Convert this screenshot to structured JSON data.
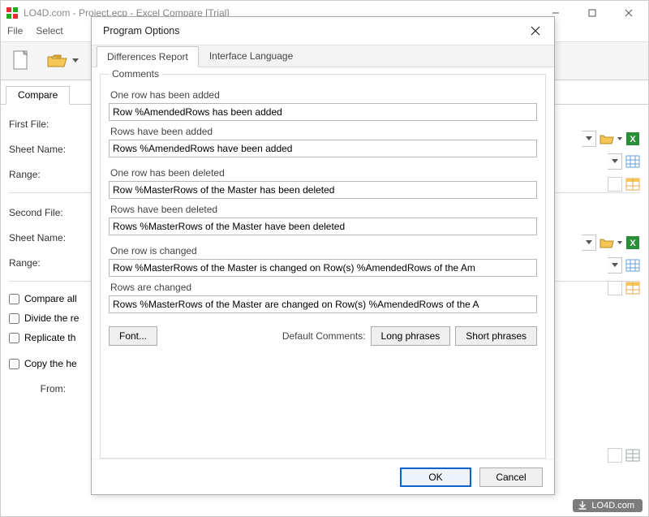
{
  "window": {
    "title": "LO4D.com - Project.ecp - Excel Compare [Trial]"
  },
  "menubar": {
    "items": [
      "File",
      "Select"
    ]
  },
  "main_tabs": {
    "compare": "Compare"
  },
  "form": {
    "first_file": "First File:",
    "second_file": "Second File:",
    "sheet_name": "Sheet Name:",
    "range": "Range:",
    "compare_all": "Compare all",
    "divide": "Divide the re",
    "replicate": "Replicate th",
    "copy_header": "Copy the he",
    "from": "From:"
  },
  "dialog": {
    "title": "Program Options",
    "tabs": {
      "diff": "Differences Report",
      "lang": "Interface Language"
    },
    "group": "Comments",
    "labels": {
      "l1": "One row has been added",
      "l2": "Rows have been added",
      "l3": "One row has been deleted",
      "l4": "Rows have been deleted",
      "l5": "One row is changed",
      "l6": "Rows are changed"
    },
    "values": {
      "v1": "Row %AmendedRows has been added",
      "v2": "Rows %AmendedRows have been added",
      "v3": "Row %MasterRows of the Master has been deleted",
      "v4": "Rows %MasterRows of the Master have been deleted",
      "v5": "Row %MasterRows of the Master is changed on Row(s) %AmendedRows of the Am",
      "v6": "Rows %MasterRows of the Master are changed on Row(s) %AmendedRows of the A"
    },
    "font_btn": "Font...",
    "default_comments": "Default Comments:",
    "long": "Long phrases",
    "short": "Short phrases",
    "ok": "OK",
    "cancel": "Cancel"
  },
  "watermark": "LO4D.com"
}
